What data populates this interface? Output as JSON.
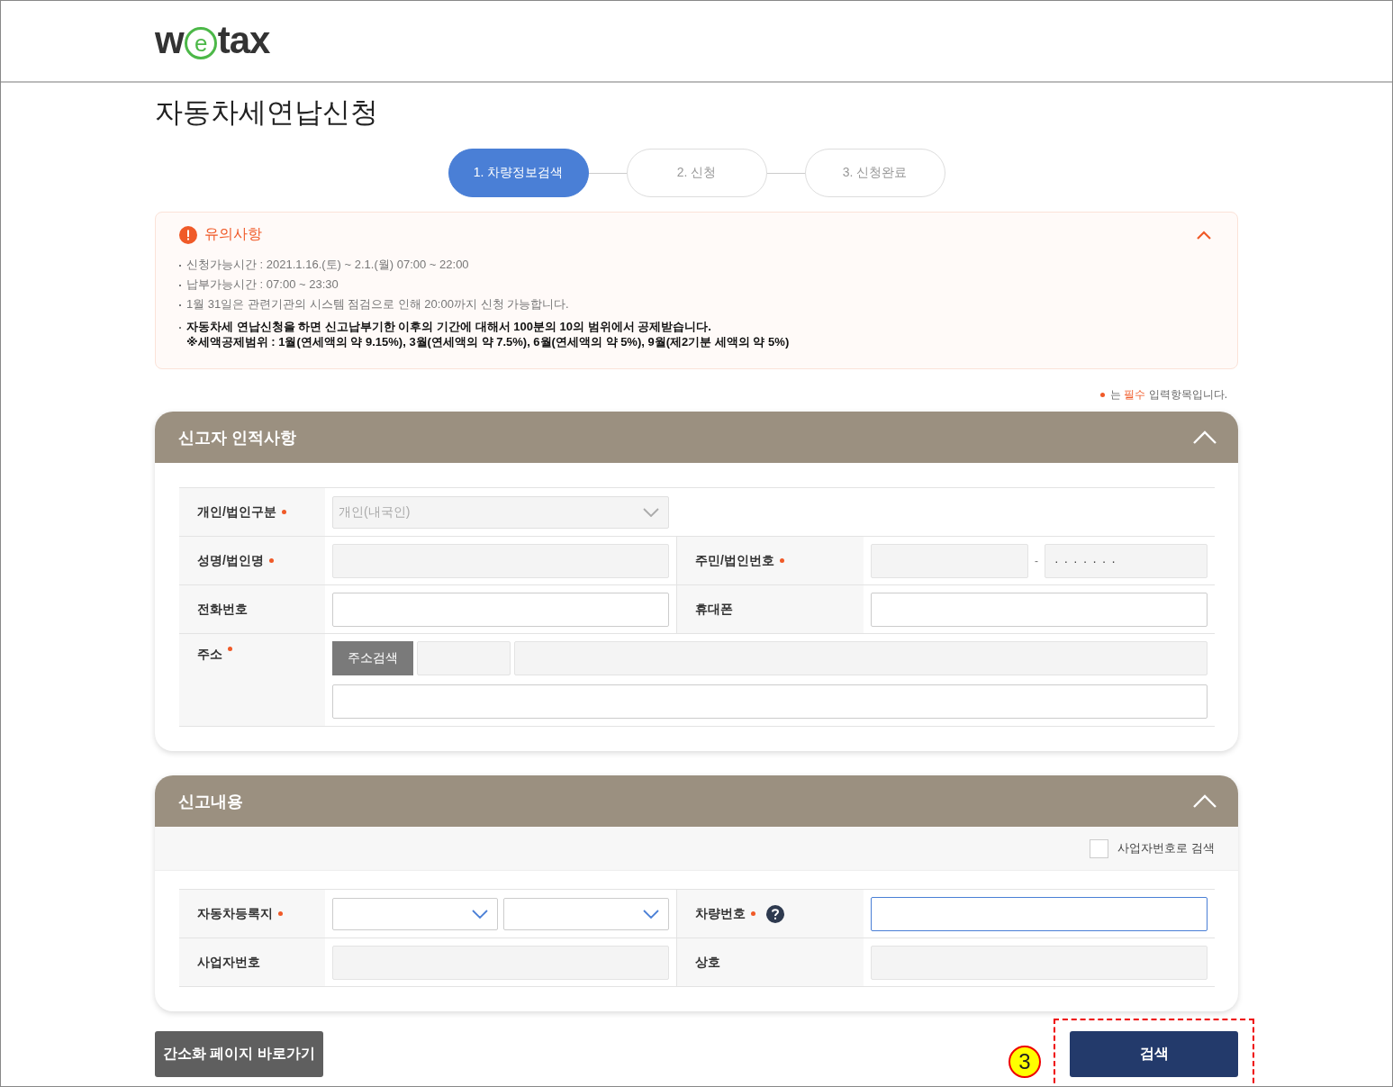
{
  "logo": {
    "before": "w",
    "mark": "e",
    "after": "tax"
  },
  "page_title": "자동차세연납신청",
  "steps": [
    {
      "label": "1. 차량정보검색",
      "selected": true
    },
    {
      "label": "2. 신청",
      "selected": false
    },
    {
      "label": "3. 신청완료",
      "selected": false
    }
  ],
  "notice": {
    "title": "유의사항",
    "expanded": true,
    "items": [
      {
        "text": "신청가능시간 : 2021.1.16.(토) ~ 2.1.(월) 07:00 ~ 22:00",
        "bold": false
      },
      {
        "text": "납부가능시간 : 07:00 ~ 23:30",
        "bold": false
      },
      {
        "text": "1월 31일은 관련기관의 시스템 점검으로 인해 20:00까지 신청 가능합니다.",
        "bold": false
      },
      {
        "text": "자동차세 연납신청을 하면 신고납부기한 이후의 기간에 대해서 100분의 10의 범위에서 공제받습니다.",
        "bold": true,
        "note": "※세액공제범위 : 1월(연세액의 약 9.15%), 3월(연세액의 약 7.5%), 6월(연세액의 약 5%), 9월(제2기분 세액의 약 5%)"
      }
    ]
  },
  "required_note": {
    "before": "는 ",
    "highlight": "필수",
    "after": " 입력항목입니다."
  },
  "sections": [
    {
      "title": "신고자 인적사항",
      "expanded": true,
      "rows": [
        [
          {
            "label": "개인/법인구분",
            "required": true,
            "control": {
              "kind": "select",
              "value": "개인(내국인)",
              "disabled": true
            }
          }
        ],
        [
          {
            "label": "성명/법인명",
            "required": true,
            "control": {
              "kind": "input",
              "disabled": true
            }
          },
          {
            "label": "주민/법인번호",
            "required": true,
            "control": {
              "kind": "split",
              "separator": "-",
              "masked": "· · · · · · ·",
              "disabled": true
            }
          }
        ],
        [
          {
            "label": "전화번호",
            "required": false,
            "control": {
              "kind": "input",
              "disabled": false
            }
          },
          {
            "label": "휴대폰",
            "required": false,
            "control": {
              "kind": "input",
              "disabled": false
            }
          }
        ],
        [
          {
            "label": "주소",
            "required": true,
            "control": {
              "kind": "address",
              "button": "주소검색"
            }
          }
        ]
      ]
    },
    {
      "title": "신고내용",
      "expanded": true,
      "option": {
        "label": "사업자번호로 검색",
        "checked": false
      },
      "rows": [
        [
          {
            "label": "자동차등록지",
            "required": true,
            "control": {
              "kind": "select-pair"
            }
          },
          {
            "label": "차량번호",
            "required": true,
            "help": true,
            "control": {
              "kind": "input",
              "disabled": false,
              "focused": true
            }
          }
        ],
        [
          {
            "label": "사업자번호",
            "required": false,
            "control": {
              "kind": "input",
              "disabled": true
            }
          },
          {
            "label": "상호",
            "required": false,
            "control": {
              "kind": "input",
              "disabled": true
            }
          }
        ]
      ]
    }
  ],
  "buttons": {
    "simple": "간소화 페이지 바로가기",
    "search": "검색",
    "annotation": "3"
  }
}
